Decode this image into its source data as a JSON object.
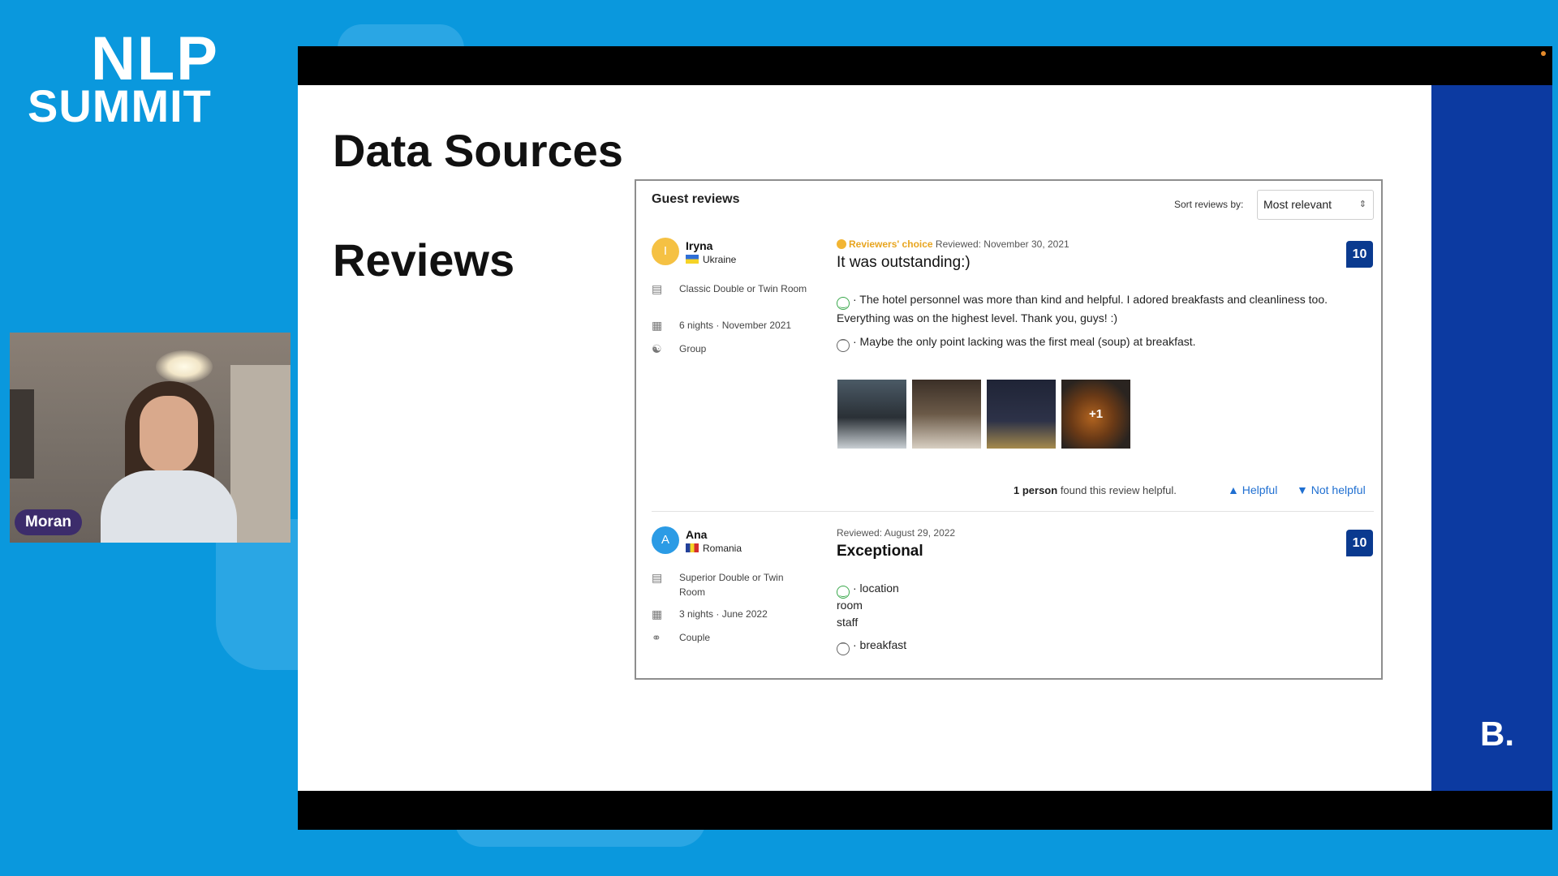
{
  "logo": {
    "line1": "NLP",
    "line2": "SUMMIT"
  },
  "speaker": {
    "name": "Moran"
  },
  "slide": {
    "title": "Data Sources",
    "subtitle": "Reviews",
    "brand_mark": "B."
  },
  "reviews_panel": {
    "heading": "Guest reviews",
    "sort_label": "Sort reviews by:",
    "sort_value": "Most relevant",
    "reviews": [
      {
        "avatar_letter": "I",
        "name": "Iryna",
        "country": "Ukraine",
        "room": "Classic Double or Twin Room",
        "stay": "6 nights · November 2021",
        "traveler_type": "Group",
        "badge": "Reviewers' choice",
        "reviewed": "Reviewed: November 30, 2021",
        "title": "It was outstanding:)",
        "score": "10",
        "positive": "· The hotel personnel was more than kind and helpful. I adored breakfasts and cleanliness too. Everything was on the highest level. Thank you, guys! :)",
        "negative": "· Maybe the only point lacking was the first meal (soup) at breakfast.",
        "photo_more": "+1",
        "helpful_count": "1 person",
        "helpful_text": "found this review helpful.",
        "helpful_btn": "Helpful",
        "not_helpful_btn": "Not helpful"
      },
      {
        "avatar_letter": "A",
        "name": "Ana",
        "country": "Romania",
        "room": "Superior Double or Twin Room",
        "stay": "3 nights · June 2022",
        "traveler_type": "Couple",
        "reviewed": "Reviewed: August 29, 2022",
        "title": "Exceptional",
        "score": "10",
        "positive_lines": [
          "· location",
          "room",
          "staff"
        ],
        "negative": "· breakfast"
      }
    ]
  },
  "colors": {
    "background": "#0a98dd",
    "side_panel": "#0c3aa1",
    "score_badge": "#0a3a8f",
    "link": "#1f6fd1",
    "reviewers_choice": "#e8a51f"
  }
}
